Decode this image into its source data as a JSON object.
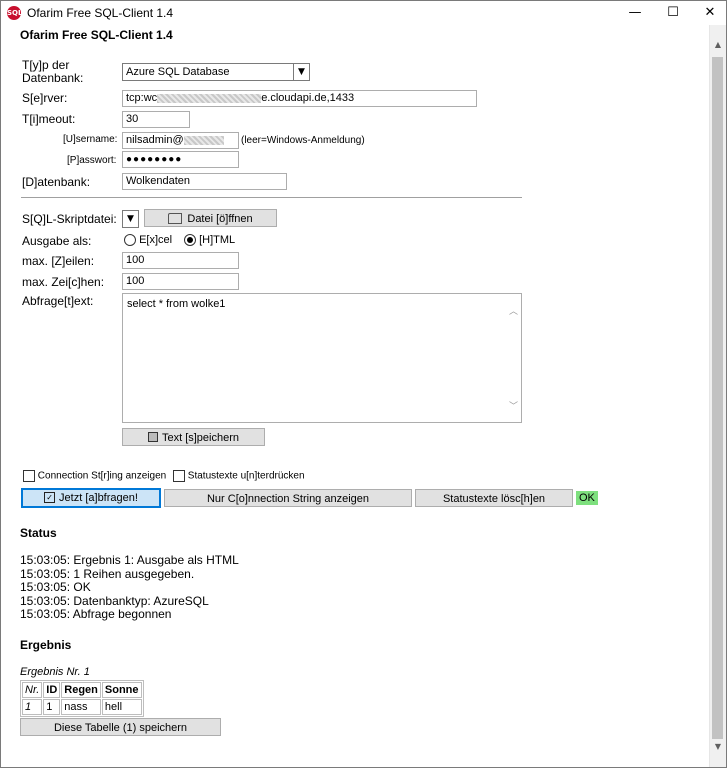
{
  "window": {
    "title": "Ofarim Free SQL-Client 1.4",
    "icon_text": "SQL"
  },
  "titlebar_controls": {
    "minimize": "—",
    "maximize": "☐",
    "close": "✕"
  },
  "form": {
    "heading": "Ofarim Free SQL-Client 1.4",
    "db_type_label_line1": "T[y]p der",
    "db_type_label_line2": "Datenbank:",
    "db_type_value": "Azure SQL Database",
    "server_label": "S[e]rver:",
    "server_value_start": "tcp:wc",
    "server_value_end": "e.cloudapi.de,1433",
    "timeout_label": "T[i]meout:",
    "timeout_value": "30",
    "username_label": "[U]sername:",
    "username_value": "nilsadmin@",
    "username_hint": "(leer=Windows-Anmeldung)",
    "password_label": "[P]asswort:",
    "password_value": "●●●●●●●●",
    "database_label": "[D]atenbank:",
    "database_value": "Wolkendaten",
    "script_label": "S[Q]L-Skriptdatei:",
    "open_file_button": "Datei [ö]ffnen",
    "output_label": "Ausgabe als:",
    "output_excel": "E[x]cel",
    "output_html": "[H]TML",
    "max_rows_label": "max. [Z]eilen:",
    "max_rows_value": "100",
    "max_chars_label": "max. Zei[c]hen:",
    "max_chars_value": "100",
    "query_label": "Abfrage[t]ext:",
    "query_value": "select * from wolke1",
    "save_text_button": "Text [s]peichern",
    "show_conn_string_checkbox": "Connection St[r]ing anzeigen",
    "suppress_status_checkbox": "Statustexte u[n]terdrücken"
  },
  "actions": {
    "query_now": "Jetzt [a]bfragen!",
    "only_conn_string": "Nur C[o]nnection String anzeigen",
    "clear_status": "Statustexte lösc[h]en",
    "ok_badge": "OK"
  },
  "status": {
    "heading": "Status",
    "lines": [
      "15:03:05: Ergebnis 1: Ausgabe als HTML",
      "15:03:05: 1 Reihen ausgegeben.",
      "15:03:05: OK",
      "15:03:05: Datenbanktyp: AzureSQL",
      "15:03:05: Abfrage begonnen"
    ]
  },
  "result": {
    "heading": "Ergebnis",
    "caption": "Ergebnis Nr. 1",
    "columns": [
      "Nr.",
      "ID",
      "Regen",
      "Sonne"
    ],
    "rows": [
      [
        "1",
        "1",
        "nass",
        "hell"
      ]
    ],
    "save_table_button": "Diese Tabelle (1) speichern"
  },
  "scrollbar": {
    "up_arrow": "▲",
    "down_arrow": "▼"
  }
}
